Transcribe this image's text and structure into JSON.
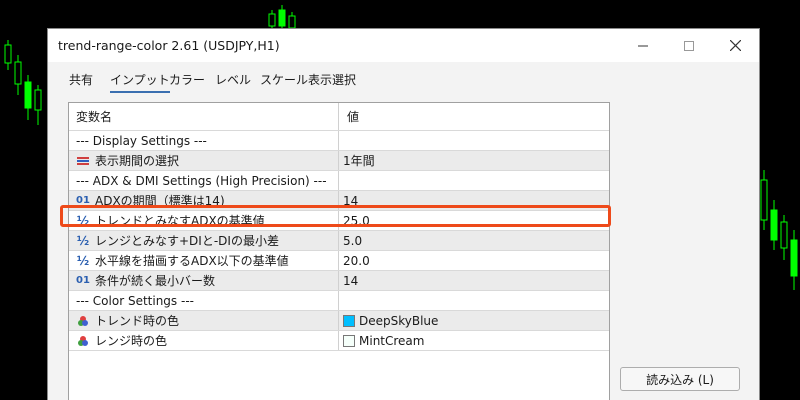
{
  "window": {
    "title": "trend-range-color 2.61 (USDJPY,H1)"
  },
  "tabs": [
    {
      "label": "共有"
    },
    {
      "label": "インプット"
    },
    {
      "label": "カラー"
    },
    {
      "label": "レベル"
    },
    {
      "label": "スケール"
    },
    {
      "label": "表示選択"
    }
  ],
  "active_tab": "インプット",
  "table": {
    "columns": [
      "変数名",
      "値"
    ],
    "rows": [
      {
        "icon": "",
        "name": "--- Display Settings ---",
        "value": ""
      },
      {
        "icon": "enum-icon",
        "name": "表示期間の選択",
        "value": "1年間"
      },
      {
        "icon": "",
        "name": "--- ADX & DMI Settings (High Precision) ---",
        "value": ""
      },
      {
        "icon": "integer-icon",
        "icon_text": "01",
        "name": "ADXの期間（標準は14)",
        "value": "14"
      },
      {
        "icon": "double-icon",
        "icon_text": "½",
        "name": "トレンドとみなすADXの基準値",
        "value": "25.0"
      },
      {
        "icon": "double-icon",
        "icon_text": "½",
        "name": "レンジとみなす+DIと-DIの最小差",
        "value": "5.0"
      },
      {
        "icon": "double-icon",
        "icon_text": "½",
        "name": "水平線を描画するADX以下の基準値",
        "value": "20.0"
      },
      {
        "icon": "integer-icon",
        "icon_text": "01",
        "name": "条件が続く最小バー数",
        "value": "14"
      },
      {
        "icon": "",
        "name": "--- Color Settings ---",
        "value": ""
      },
      {
        "icon": "color-icon",
        "name": "トレンド時の色",
        "value": "DeepSkyBlue",
        "swatch": "#00bfff"
      },
      {
        "icon": "color-icon",
        "name": "レンジ時の色",
        "value": "MintCream",
        "swatch": "#f5fffa"
      }
    ]
  },
  "buttons": {
    "load": "読み込み (L)"
  },
  "colors": {
    "highlight": "#ee4a1a",
    "chart_up": "#00ff00",
    "tab_underline": "#3a6fb0"
  }
}
